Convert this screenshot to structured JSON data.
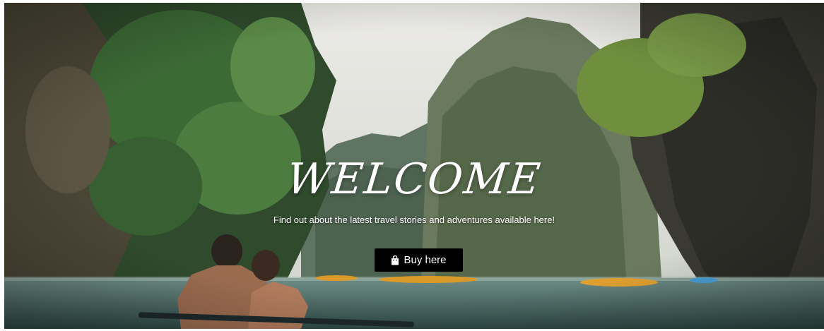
{
  "hero": {
    "title": "WELCOME",
    "tagline": "Find out about the latest travel stories and adventures available here!",
    "button_label": "Buy here",
    "button_icon": "shopping-bag-icon",
    "button_bg": "#000000",
    "text_color": "#ffffff"
  }
}
